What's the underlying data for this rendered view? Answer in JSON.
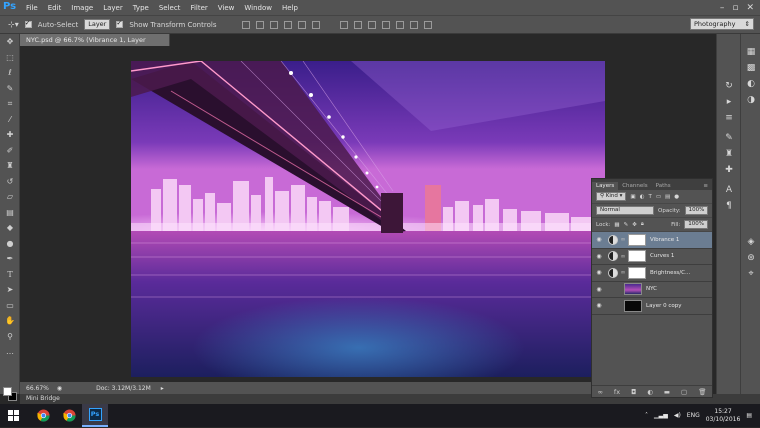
{
  "app": {
    "logo": "Ps"
  },
  "menu": [
    "File",
    "Edit",
    "Image",
    "Layer",
    "Type",
    "Select",
    "Filter",
    "View",
    "Window",
    "Help"
  ],
  "window_controls": {
    "minimize": "–",
    "restore": "▫",
    "close": "✕"
  },
  "options_bar": {
    "auto_select_label": "Auto-Select",
    "auto_select_target": "Layer",
    "show_transform_label": "Show Transform Controls",
    "workspace": "Photography"
  },
  "document": {
    "tab_title": "NYC.psd @ 66.7% (Vibrance 1, Layer Mask/8) *",
    "zoom": "66.67%",
    "doc_size": "Doc: 3.12M/3.12M"
  },
  "mini_bridge_label": "Mini Bridge",
  "layers_panel": {
    "tabs": [
      "Layers",
      "Channels",
      "Paths"
    ],
    "kind_filter": "Kind",
    "blend_mode": "Normal",
    "opacity_label": "Opacity:",
    "opacity_value": "100%",
    "lock_label": "Lock:",
    "fill_label": "Fill:",
    "fill_value": "100%",
    "layers": [
      {
        "name": "Vibrance 1",
        "type": "adjustment",
        "active": true
      },
      {
        "name": "Curves 1",
        "type": "adjustment",
        "active": false
      },
      {
        "name": "Brightness/C...",
        "type": "adjustment",
        "active": false
      },
      {
        "name": "NYC",
        "type": "image",
        "active": false
      },
      {
        "name": "Layer 0 copy",
        "type": "image-dark",
        "active": false
      }
    ]
  },
  "taskbar": {
    "apps": [
      "windows-start",
      "chrome",
      "chrome",
      "photoshop"
    ],
    "language": "ENG",
    "time": "15:27",
    "date": "03/10/2016"
  },
  "colors": {
    "chrome_bg": "#535353",
    "canvas_bg": "#282828",
    "accent_blue": "#33a3ff",
    "active_layer": "#6b7d92"
  }
}
